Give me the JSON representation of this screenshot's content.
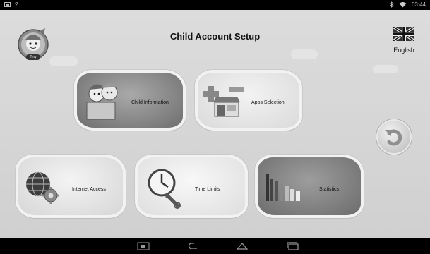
{
  "status_bar": {
    "time": "03:44",
    "left_icons": [
      "screenshot-icon",
      "question-icon"
    ],
    "right_icons": [
      "bluetooth-icon",
      "wifi-icon"
    ]
  },
  "header": {
    "title": "Child Account Setup",
    "avatar_name": "Tiny"
  },
  "language": {
    "label": "English",
    "flag_icon": "uk-flag-icon"
  },
  "tiles": {
    "child_information": {
      "label": "Child Information",
      "icon": "children-box-icon"
    },
    "apps_selection": {
      "label": "Apps Selection",
      "icon": "plus-minus-store-icon"
    },
    "internet_access": {
      "label": "Internet Access",
      "icon": "globe-gear-icon"
    },
    "time_limits": {
      "label": "Time Limits",
      "icon": "clock-wrench-icon"
    },
    "statistics": {
      "label": "Statistics",
      "icon": "bar-chart-icon"
    }
  },
  "back_button": {
    "icon": "undo-arrow-icon"
  },
  "nav_bar": {
    "buttons": [
      "screenshot-icon",
      "back-icon",
      "home-icon",
      "recent-apps-icon"
    ]
  },
  "colors": {
    "background": "#d6d6d6",
    "tile_dark": "#7c7c7c",
    "tile_light": "#e8e8e8",
    "tile_border": "#f2f2f2"
  }
}
